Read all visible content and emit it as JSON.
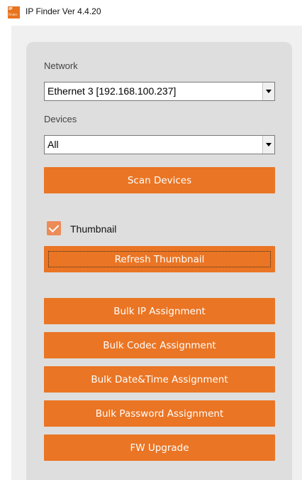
{
  "window": {
    "title": "IP Finder  Ver 4.4.20",
    "icon": "app-logo-icon",
    "icon_text": [
      "IP",
      "Finder"
    ]
  },
  "network": {
    "label": "Network",
    "selected": "Ethernet 3 [192.168.100.237]"
  },
  "devices": {
    "label": "Devices",
    "selected": "All"
  },
  "buttons": {
    "scan": "Scan Devices",
    "refresh_thumbnail": "Refresh Thumbnail",
    "bulk_ip": "Bulk IP Assignment",
    "bulk_codec": "Bulk Codec Assignment",
    "bulk_datetime": "Bulk Date&Time Assignment",
    "bulk_password": "Bulk Password Assignment",
    "fw_upgrade": "FW Upgrade"
  },
  "thumbnail": {
    "label": "Thumbnail",
    "checked": true
  },
  "colors": {
    "accent": "#ea7524",
    "checkbox": "#ec8b58",
    "panel": "#dedede"
  }
}
